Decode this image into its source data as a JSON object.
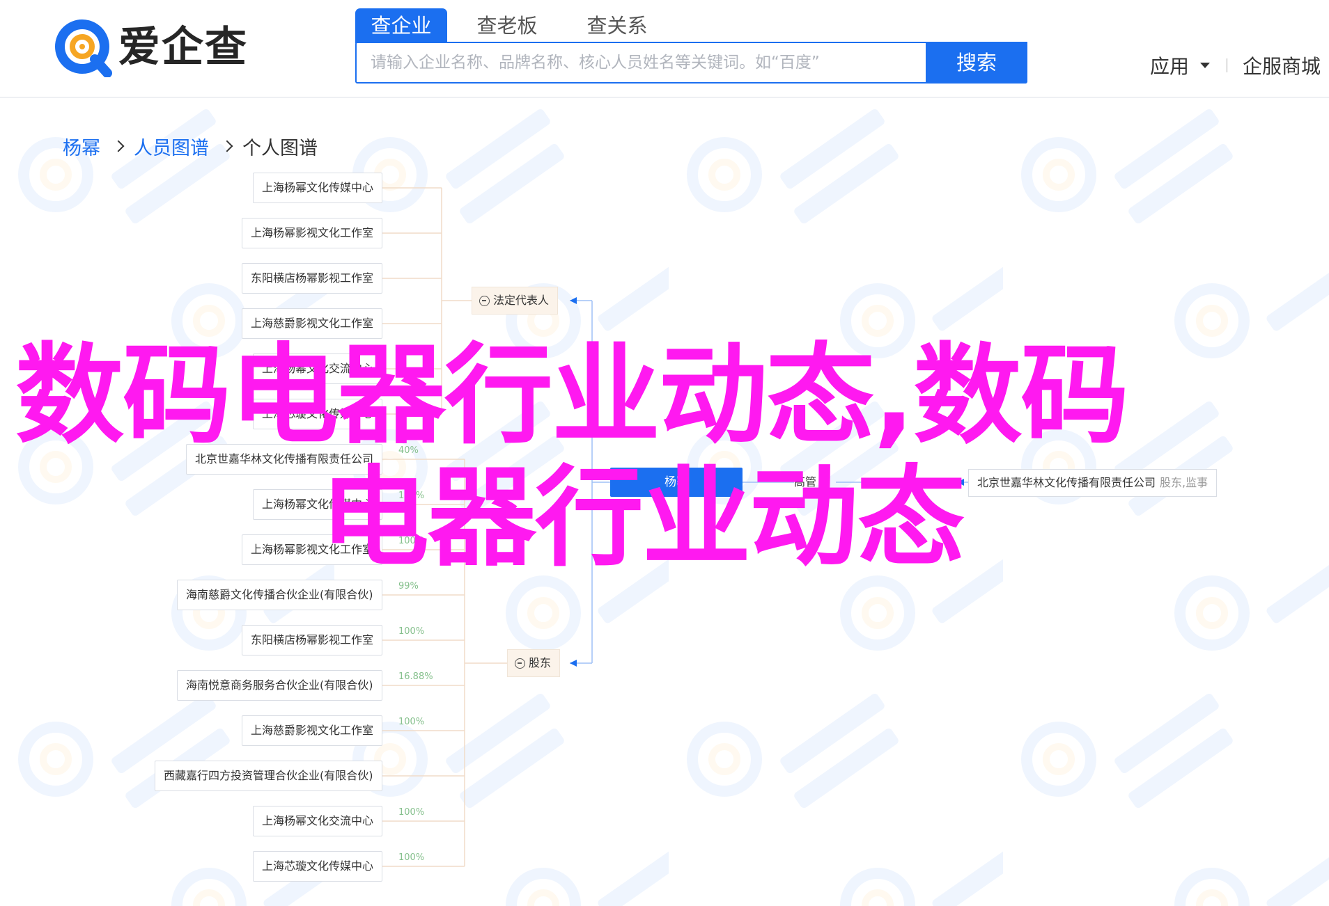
{
  "header": {
    "logo_text": "爱企查",
    "tabs": [
      {
        "label": "查企业",
        "active": true
      },
      {
        "label": "查老板",
        "active": false
      },
      {
        "label": "查关系",
        "active": false
      }
    ],
    "search": {
      "placeholder": "请输入企业名称、品牌名称、核心人员姓名等关键词。如“百度”",
      "button_label": "搜索"
    },
    "nav": {
      "apply_label": "应用",
      "biz_label": "企服商城"
    }
  },
  "breadcrumb": {
    "items": [
      "杨幂",
      "人员图谱",
      "个人图谱"
    ]
  },
  "tree": {
    "center": "杨幂",
    "legal_rep_label": "法定代表人",
    "shareholder_label": "股东",
    "investee_label": "高管",
    "investee": {
      "name": "北京世嘉华林文化传播有限责任公司",
      "role": "股东,监事"
    },
    "legal_rep_nodes": [
      "上海杨幂文化传媒中心",
      "上海杨幂影视文化工作室",
      "东阳横店杨幂影视工作室",
      "上海慈爵影视文化工作室",
      "上海杨幂文化交流中心",
      "上海芯璇文化传媒中心",
      "北京世嘉华林文化传播有限责任公司",
      "上海杨幂文化传媒中心",
      "上海杨幂影视文化工作室"
    ],
    "shareholder_nodes": [
      {
        "name": "北京世嘉华林文化传播有限责任公司",
        "pct": "40%"
      },
      {
        "name": "上海杨幂文化传媒中心",
        "pct": "100%"
      },
      {
        "name": "上海杨幂影视文化工作室",
        "pct": "100%"
      },
      {
        "name": "海南慈爵文化传播合伙企业(有限合伙)",
        "pct": "99%"
      },
      {
        "name": "东阳横店杨幂影视工作室",
        "pct": "100%"
      },
      {
        "name": "海南悦意商务服务合伙企业(有限合伙)",
        "pct": "16.88%"
      },
      {
        "name": "上海慈爵影视文化工作室",
        "pct": "100%"
      },
      {
        "name": "西藏嘉行四方投资管理合伙企业(有限合伙)",
        "pct": ""
      },
      {
        "name": "上海杨幂文化交流中心",
        "pct": "100%"
      },
      {
        "name": "上海芯璇文化传媒中心",
        "pct": "100%"
      }
    ]
  },
  "overlay": {
    "line1": "数码电器行业动态,数码",
    "line2": "电器行业动态"
  },
  "colors": {
    "brand_blue": "#1b6ff0",
    "overlay_magenta": "#ff19f0",
    "pct_green": "#86c08d",
    "group_bg": "#fbf3ea"
  }
}
